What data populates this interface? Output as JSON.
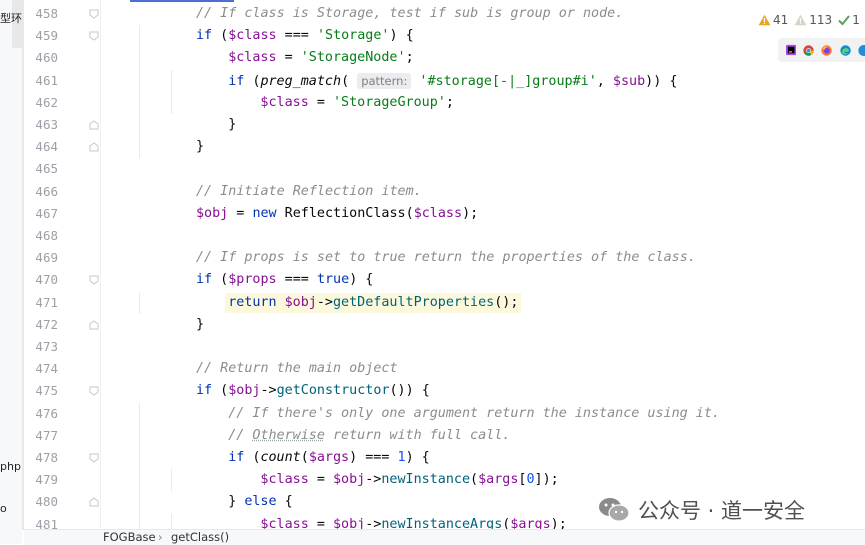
{
  "sidebar": {
    "items": [
      "型环\\",
      "php",
      "o"
    ]
  },
  "inspections": {
    "warnings": "41",
    "weak_warnings": "113",
    "typos": "1"
  },
  "browsers": [
    "phpstorm-icon",
    "chrome-icon",
    "firefox-icon",
    "edge-icon",
    "other-browser-icon"
  ],
  "breadcrumb": {
    "class": "FOGBase",
    "method": "getClass()"
  },
  "watermark": "公众号 · 道一安全",
  "editor": {
    "lines": [
      {
        "no": "458",
        "segs": [
          {
            "t": "// If class is Storage, test if sub is group or node.",
            "c": "cmt"
          }
        ]
      },
      {
        "no": "459",
        "segs": [
          {
            "t": "if",
            "c": "kw"
          },
          {
            "t": " ("
          },
          {
            "t": "$class",
            "c": "var"
          },
          {
            "t": " === "
          },
          {
            "t": "'Storage'",
            "c": "str"
          },
          {
            "t": ") {"
          }
        ]
      },
      {
        "no": "460",
        "segs": [
          {
            "t": "$class",
            "c": "var"
          },
          {
            "t": " = "
          },
          {
            "t": "'StorageNode'",
            "c": "str"
          },
          {
            "t": ";"
          }
        ]
      },
      {
        "no": "461",
        "segs": [
          {
            "t": "if",
            "c": "kw"
          },
          {
            "t": " ("
          },
          {
            "t": "preg_match",
            "c": "fn-it"
          },
          {
            "t": "( "
          },
          {
            "t": "pattern:",
            "c": "hint"
          },
          {
            "t": " "
          },
          {
            "t": "'#storage[-|_]group#i'",
            "c": "str"
          },
          {
            "t": ", "
          },
          {
            "t": "$sub",
            "c": "var"
          },
          {
            "t": ")) {"
          }
        ]
      },
      {
        "no": "462",
        "segs": [
          {
            "t": "$class",
            "c": "var"
          },
          {
            "t": " = "
          },
          {
            "t": "'StorageGroup'",
            "c": "str"
          },
          {
            "t": ";"
          }
        ]
      },
      {
        "no": "463",
        "segs": [
          {
            "t": "}"
          }
        ]
      },
      {
        "no": "464",
        "segs": [
          {
            "t": "}"
          }
        ]
      },
      {
        "no": "465",
        "segs": []
      },
      {
        "no": "466",
        "segs": [
          {
            "t": "// Initiate Reflection item.",
            "c": "cmt"
          }
        ]
      },
      {
        "no": "467",
        "segs": [
          {
            "t": "$obj",
            "c": "var"
          },
          {
            "t": " = "
          },
          {
            "t": "new",
            "c": "kw"
          },
          {
            "t": " ReflectionClass("
          },
          {
            "t": "$class",
            "c": "var"
          },
          {
            "t": ");"
          }
        ]
      },
      {
        "no": "468",
        "segs": []
      },
      {
        "no": "469",
        "segs": [
          {
            "t": "// If props is set to true return the properties of the class.",
            "c": "cmt"
          }
        ]
      },
      {
        "no": "470",
        "segs": [
          {
            "t": "if",
            "c": "kw"
          },
          {
            "t": " ("
          },
          {
            "t": "$props",
            "c": "var"
          },
          {
            "t": " === "
          },
          {
            "t": "true",
            "c": "kw"
          },
          {
            "t": ") {"
          }
        ]
      },
      {
        "no": "471",
        "segs": [
          {
            "t": "return",
            "c": "kw"
          },
          {
            "t": " "
          },
          {
            "t": "$obj",
            "c": "var"
          },
          {
            "t": "->"
          },
          {
            "t": "getDefaultProperties",
            "c": "fn"
          },
          {
            "t": "();"
          }
        ]
      },
      {
        "no": "472",
        "segs": [
          {
            "t": "}"
          }
        ]
      },
      {
        "no": "473",
        "segs": []
      },
      {
        "no": "474",
        "segs": [
          {
            "t": "// Return the main object",
            "c": "cmt"
          }
        ]
      },
      {
        "no": "475",
        "segs": [
          {
            "t": "if",
            "c": "kw"
          },
          {
            "t": " ("
          },
          {
            "t": "$obj",
            "c": "var"
          },
          {
            "t": "->"
          },
          {
            "t": "getConstructor",
            "c": "fn"
          },
          {
            "t": "()) {"
          }
        ]
      },
      {
        "no": "476",
        "segs": [
          {
            "t": "// If there's only one argument return the instance using it.",
            "c": "cmt"
          }
        ]
      },
      {
        "no": "477",
        "segs": [
          {
            "t": "// ",
            "c": "cmt"
          },
          {
            "t": "Otherwise",
            "c": "cmt-u"
          },
          {
            "t": " return with full call.",
            "c": "cmt"
          }
        ]
      },
      {
        "no": "478",
        "segs": [
          {
            "t": "if",
            "c": "kw"
          },
          {
            "t": " ("
          },
          {
            "t": "count",
            "c": "fn-it"
          },
          {
            "t": "("
          },
          {
            "t": "$args",
            "c": "var"
          },
          {
            "t": ") === "
          },
          {
            "t": "1",
            "c": "num"
          },
          {
            "t": ") {"
          }
        ]
      },
      {
        "no": "479",
        "segs": [
          {
            "t": "$class",
            "c": "var"
          },
          {
            "t": " = "
          },
          {
            "t": "$obj",
            "c": "var"
          },
          {
            "t": "->"
          },
          {
            "t": "newInstance",
            "c": "fn"
          },
          {
            "t": "("
          },
          {
            "t": "$args",
            "c": "var"
          },
          {
            "t": "["
          },
          {
            "t": "0",
            "c": "num"
          },
          {
            "t": "]);"
          }
        ]
      },
      {
        "no": "480",
        "segs": [
          {
            "t": "} "
          },
          {
            "t": "else",
            "c": "kw"
          },
          {
            "t": " {"
          }
        ]
      },
      {
        "no": "481",
        "segs": [
          {
            "t": "$class",
            "c": "var"
          },
          {
            "t": " = "
          },
          {
            "t": "$obj",
            "c": "var"
          },
          {
            "t": "->"
          },
          {
            "t": "newInstanceArgs",
            "c": "fn"
          },
          {
            "t": "("
          },
          {
            "t": "$args",
            "c": "var"
          },
          {
            "t": ");"
          }
        ]
      }
    ]
  }
}
